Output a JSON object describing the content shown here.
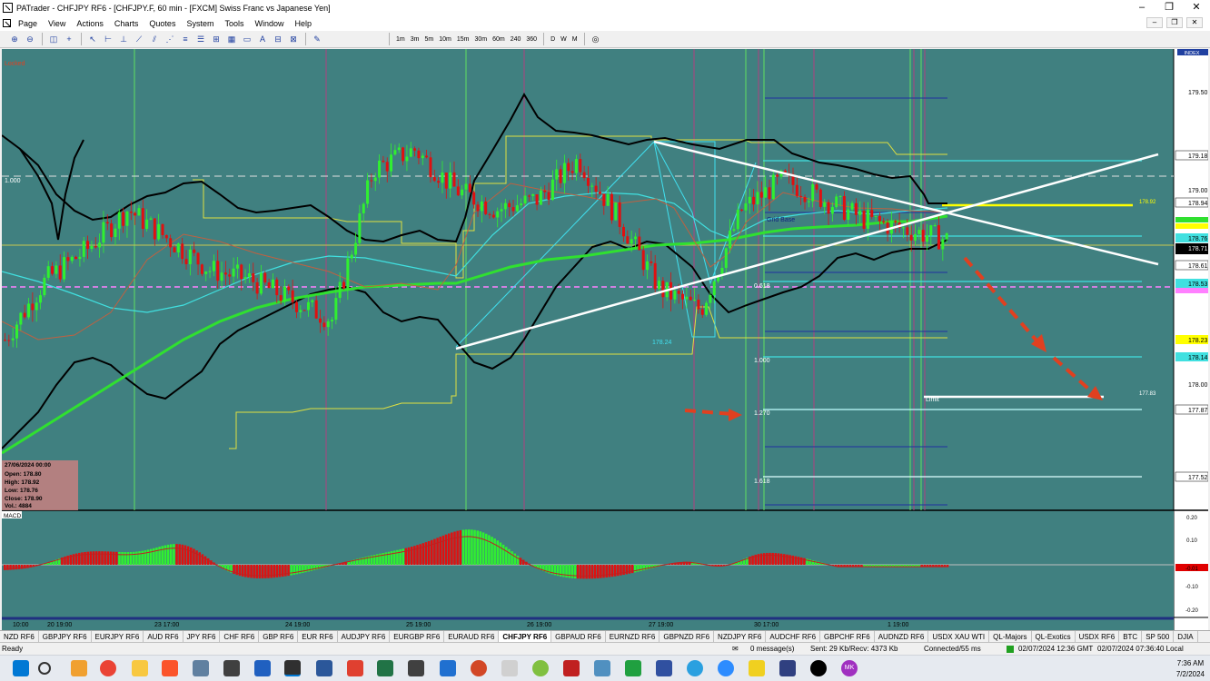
{
  "window": {
    "title": "PATrader - CHFJPY RF6 - [CHFJPY.F, 60 min - [FXCM] Swiss Franc vs Japanese Yen]",
    "minimize": "–",
    "maximize": "❐",
    "close": "✕"
  },
  "menu": [
    "Page",
    "View",
    "Actions",
    "Charts",
    "Quotes",
    "System",
    "Tools",
    "Window",
    "Help"
  ],
  "timeframes": [
    "1m",
    "3m",
    "5m",
    "10m",
    "15m",
    "30m",
    "60m",
    "240",
    "360",
    "D",
    "W",
    "M"
  ],
  "chart": {
    "locked_label": "Locked",
    "index_label": "INDEX",
    "price_levels": [
      "179.50",
      "179.18",
      "179.00",
      "178.94",
      "178.76",
      "178.71",
      "178.61",
      "178.53",
      "178.23",
      "178.14",
      "178.00",
      "177.87",
      "177.52"
    ],
    "fib_labels": [
      "1.000",
      "1.270",
      "1.618",
      "0.618"
    ],
    "left_fib_label": "1.000",
    "low_label": "178.24",
    "grid_base_label": "Grid Base",
    "yellow_level_label": "178.92",
    "limit_label": "Limit",
    "limit_value": "177.83",
    "ohlc": {
      "date": "27/06/2024 00:00",
      "open": "Open: 178.80",
      "high": "High: 178.92",
      "low": "Low: 178.76",
      "close": "Close: 178.90",
      "vol": "Vol.: 4884"
    },
    "macd": {
      "label": "MACD",
      "scale": [
        "0.20",
        "0.10",
        "-0.10",
        "-0.20"
      ],
      "current": "-0.01"
    },
    "time_labels": [
      "10:00",
      "20 19:00",
      "23 17:00",
      "24 19:00",
      "25 19:00",
      "26 19:00",
      "27 19:00",
      "30 17:00",
      "1 19:00"
    ]
  },
  "chart_data": {
    "type": "line",
    "title": "CHFJPY.F, 60 min",
    "series": [
      {
        "name": "",
        "values": [
          178.25,
          178.55,
          178.7,
          178.9,
          178.75,
          178.6,
          178.55,
          178.45,
          178.35,
          179.1,
          179.2,
          179.0,
          178.9,
          178.95,
          179.15,
          178.85,
          178.5,
          178.4,
          178.9,
          179.05,
          178.95,
          178.85,
          178.8,
          178.75
        ]
      }
    ],
    "ylim": [
      177.4,
      179.7
    ]
  },
  "symbols": [
    "NZD RF6",
    "GBPJPY RF6",
    "EURJPY RF6",
    "AUD RF6",
    "JPY RF6",
    "CHF RF6",
    "GBP RF6",
    "EUR RF6",
    "AUDJPY RF6",
    "EURGBP RF6",
    "EURAUD RF6",
    "CHFJPY RF6",
    "GBPAUD RF6",
    "EURNZD RF6",
    "GBPNZD RF6",
    "NZDJPY RF6",
    "AUDCHF RF6",
    "GBPCHF RF6",
    "AUDNZD RF6",
    "USDX XAU WTI",
    "QL-Majors",
    "QL-Exotics",
    "USDX RF6",
    "BTC",
    "SP 500",
    "DJIA"
  ],
  "active_symbol": "CHFJPY RF6",
  "status": {
    "ready": "Ready",
    "messages": "0 message(s)",
    "traffic": "Sent: 29 Kb/Recv: 4373 Kb",
    "connection": "Connected/55 ms",
    "gmt": "02/07/2024 12:36 GMT",
    "local": "02/07/2024 07:36:40 Local"
  },
  "taskbar": {
    "time": "7:36 AM",
    "date": "7/2/2024",
    "avatar": "MK"
  }
}
